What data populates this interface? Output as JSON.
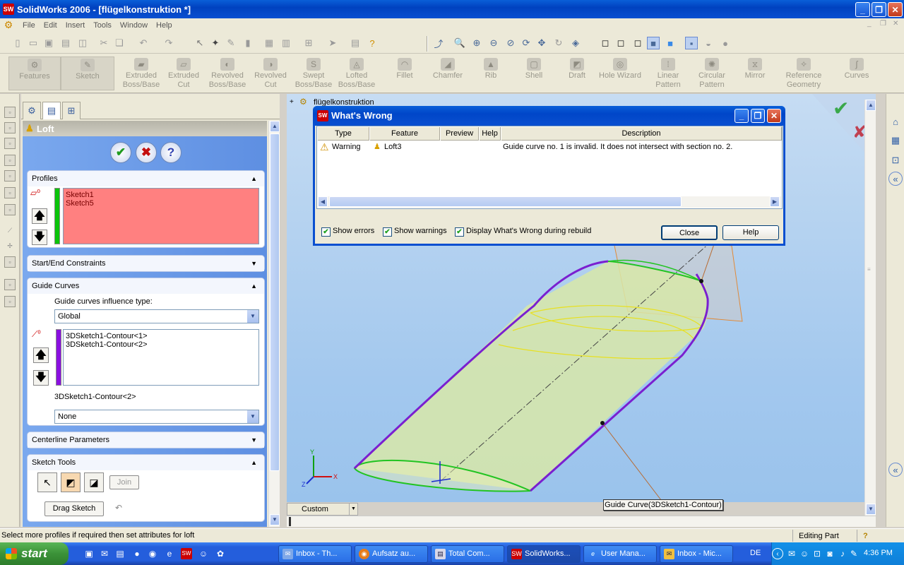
{
  "window": {
    "title": "SolidWorks 2006 - [flügelkonstruktion *]",
    "app_icon": "SW"
  },
  "menu": [
    "File",
    "Edit",
    "Insert",
    "Tools",
    "Window",
    "Help"
  ],
  "feature_toolbar": [
    {
      "label": "Features",
      "icon": "features-icon"
    },
    {
      "label": "Sketch",
      "icon": "sketch-icon"
    },
    {
      "label": "Extruded Boss/Base",
      "icon": "extrude-icon"
    },
    {
      "label": "Extruded Cut",
      "icon": "extruded-cut-icon"
    },
    {
      "label": "Revolved Boss/Base",
      "icon": "revolve-icon"
    },
    {
      "label": "Revolved Cut",
      "icon": "revolved-cut-icon"
    },
    {
      "label": "Swept Boss/Base",
      "icon": "sweep-icon"
    },
    {
      "label": "Lofted Boss/Base",
      "icon": "loft-icon"
    },
    {
      "label": "Fillet",
      "icon": "fillet-icon"
    },
    {
      "label": "Chamfer",
      "icon": "chamfer-icon"
    },
    {
      "label": "Rib",
      "icon": "rib-icon"
    },
    {
      "label": "Shell",
      "icon": "shell-icon"
    },
    {
      "label": "Draft",
      "icon": "draft-icon"
    },
    {
      "label": "Hole Wizard",
      "icon": "hole-wizard-icon"
    },
    {
      "label": "Linear Pattern",
      "icon": "linear-pattern-icon"
    },
    {
      "label": "Circular Pattern",
      "icon": "circular-pattern-icon"
    },
    {
      "label": "Mirror",
      "icon": "mirror-icon"
    },
    {
      "label": "Reference Geometry",
      "icon": "reference-geometry-icon"
    },
    {
      "label": "Curves",
      "icon": "curves-icon"
    }
  ],
  "property_manager": {
    "title": "Loft",
    "profiles": {
      "header": "Profiles",
      "items": [
        "Sketch1",
        "Sketch5"
      ]
    },
    "start_end": {
      "header": "Start/End Constraints"
    },
    "guide_curves": {
      "header": "Guide Curves",
      "influence_label": "Guide curves influence type:",
      "influence_value": "Global",
      "items": [
        "3DSketch1-Contour<1>",
        "3DSketch1-Contour<2>"
      ],
      "selected_label": "3DSketch1-Contour<2>",
      "tangency_value": "None"
    },
    "centerline": {
      "header": "Centerline Parameters"
    },
    "sketch_tools": {
      "header": "Sketch Tools",
      "join": "Join",
      "drag": "Drag Sketch"
    }
  },
  "graphics": {
    "tree_root": "flügelkonstruktion",
    "view_combo": "Custom",
    "callout": "Guide Curve(3DSketch1-Contour)",
    "colors": {
      "profile": "#22c422",
      "guide": "#7a1fd0",
      "section": "#e8e020",
      "surface": "#d8e8a8"
    }
  },
  "dialog": {
    "title": "What's Wrong",
    "columns": [
      "Type",
      "Feature",
      "Preview",
      "Help",
      "Description"
    ],
    "rows": [
      {
        "type": "Warning",
        "feature": "Loft3",
        "preview": "",
        "help": "",
        "description": "Guide curve no. 1 is invalid. It does not intersect with section no. 2."
      }
    ],
    "show_errors": "Show errors",
    "show_warnings": "Show warnings",
    "display_during_rebuild": "Display What's Wrong during rebuild",
    "close": "Close",
    "help": "Help"
  },
  "status": {
    "message": "Select more profiles if required then set attributes for loft",
    "mode": "Editing Part"
  },
  "taskbar": {
    "start": "start",
    "tasks": [
      {
        "label": "Inbox - Th...",
        "icon": "thunderbird-icon"
      },
      {
        "label": "Aufsatz au...",
        "icon": "firefox-icon"
      },
      {
        "label": "Total Com...",
        "icon": "total-commander-icon"
      },
      {
        "label": "SolidWorks...",
        "icon": "solidworks-icon",
        "active": true
      },
      {
        "label": "User Mana...",
        "icon": "ie-icon"
      },
      {
        "label": "Inbox - Mic...",
        "icon": "outlook-icon"
      }
    ],
    "lang": "DE",
    "clock": "4:36 PM"
  }
}
